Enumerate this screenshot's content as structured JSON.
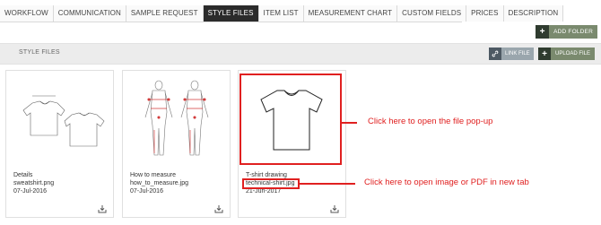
{
  "tabs": [
    {
      "label": "WORKFLOW",
      "active": false
    },
    {
      "label": "COMMUNICATION",
      "active": false
    },
    {
      "label": "SAMPLE REQUEST",
      "active": false
    },
    {
      "label": "STYLE FILES",
      "active": true
    },
    {
      "label": "ITEM LIST",
      "active": false
    },
    {
      "label": "MEASUREMENT CHART",
      "active": false
    },
    {
      "label": "CUSTOM FIELDS",
      "active": false
    },
    {
      "label": "PRICES",
      "active": false
    },
    {
      "label": "DESCRIPTION",
      "active": false
    }
  ],
  "toolbar": {
    "add_folder_icon": "+",
    "add_folder_label": "ADD FOLDER",
    "section_title": "STYLE FILES",
    "link_file_label": "LINK FILE",
    "upload_file_icon": "+",
    "upload_file_label": "UPLOAD FILE"
  },
  "files": [
    {
      "title": "Details",
      "filename": "sweatshirt.png",
      "date": "07-Jul-2016",
      "icon": "sweatshirt-sketch"
    },
    {
      "title": "How to measure",
      "filename": "how_to_measure.jpg",
      "date": "07-Jul-2016",
      "icon": "measure-figures"
    },
    {
      "title": "T-shirt drawing",
      "filename": "technical-shirt.jpg",
      "date": "21-Jun-2017",
      "icon": "tshirt-drawing"
    }
  ],
  "annotations": {
    "popup_text": "Click here to open the file pop-up",
    "newtab_text": "Click here to open image or PDF in new tab",
    "color": "#e02020"
  }
}
